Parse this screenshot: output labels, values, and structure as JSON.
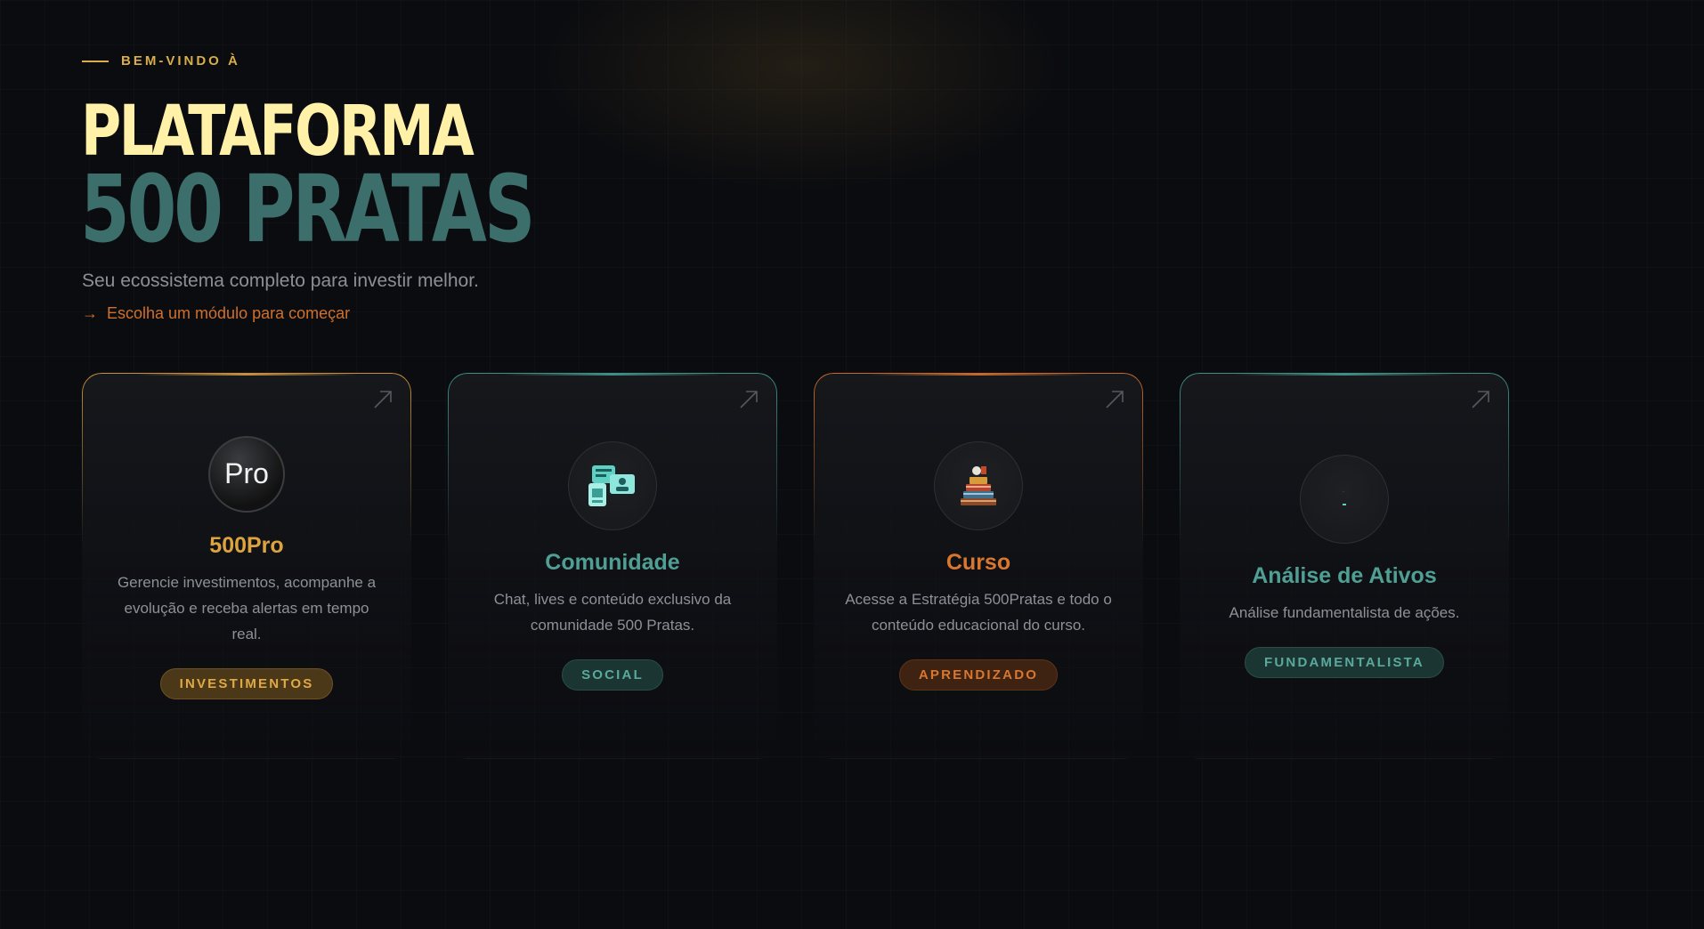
{
  "hero": {
    "eyebrow": "BEM-VINDO À",
    "title_line1": "PLATAFORMA",
    "title_line2": "500 PRATAS",
    "subtitle": "Seu ecossistema completo para investir melhor.",
    "cta_arrow": "→",
    "cta_text": "Escolha um módulo para começar"
  },
  "cards": [
    {
      "title": "500Pro",
      "description": "Gerencie investimentos, acompanhe a evolução e receba alertas em tempo real.",
      "badge": "INVESTIMENTOS",
      "icon_text": "Pro",
      "icon": "pro-logo-icon"
    },
    {
      "title": "Comunidade",
      "description": "Chat, lives e conteúdo exclusivo da comunidade 500 Pratas.",
      "badge": "SOCIAL",
      "icon": "community-chat-icon"
    },
    {
      "title": "Curso",
      "description": "Acesse a Estratégia 500Pratas e todo o conteúdo educacional do curso.",
      "badge": "APRENDIZADO",
      "icon": "books-course-icon"
    },
    {
      "title": "Análise de Ativos",
      "description": "Análise fundamentalista de ações.",
      "badge": "FUNDAMENTALISTA",
      "icon": "analysis-icon"
    }
  ],
  "colors": {
    "background": "#0b0c10",
    "gold": "#dca33f",
    "teal": "#4f9f95",
    "orange": "#d9772f",
    "title_yellow": "#fff2a8",
    "title_teal": "#3c6e6c"
  }
}
